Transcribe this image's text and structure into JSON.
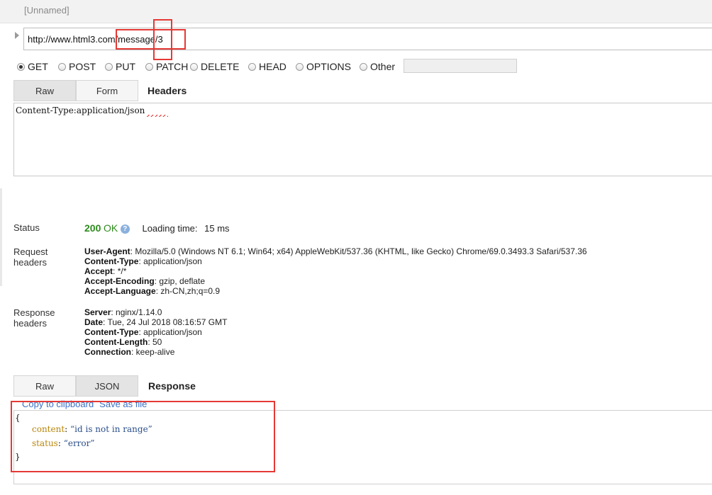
{
  "request": {
    "name": "[Unnamed]",
    "url": "http://www.html3.com/message/3",
    "methods": [
      {
        "label": "GET",
        "checked": true
      },
      {
        "label": "POST",
        "checked": false
      },
      {
        "label": "PUT",
        "checked": false
      },
      {
        "label": "PATCH",
        "checked": false
      },
      {
        "label": "DELETE",
        "checked": false
      },
      {
        "label": "HEAD",
        "checked": false
      },
      {
        "label": "OPTIONS",
        "checked": false
      },
      {
        "label": "Other",
        "checked": false
      }
    ],
    "other_value": "",
    "tabs": {
      "raw": "Raw",
      "form": "Form",
      "section_label": "Headers",
      "active": "Raw"
    },
    "headers_text": "Content-Type:application/json"
  },
  "response": {
    "status_label": "Status",
    "status_code": "200",
    "status_text": "OK",
    "help_glyph": "?",
    "loading_label": "Loading time:",
    "loading_value": "15 ms",
    "request_headers_label_1": "Request",
    "request_headers_label_2": "headers",
    "request_headers": [
      {
        "name": "User-Agent",
        "value": "Mozilla/5.0 (Windows NT 6.1; Win64; x64) AppleWebKit/537.36 (KHTML, like Gecko) Chrome/69.0.3493.3 Safari/537.36"
      },
      {
        "name": "Content-Type",
        "value": "application/json"
      },
      {
        "name": "Accept",
        "value": "*/*"
      },
      {
        "name": "Accept-Encoding",
        "value": "gzip, deflate"
      },
      {
        "name": "Accept-Language",
        "value": "zh-CN,zh;q=0.9"
      }
    ],
    "response_headers_label_1": "Response",
    "response_headers_label_2": "headers",
    "response_headers": [
      {
        "name": "Server",
        "value": "nginx/1.14.0"
      },
      {
        "name": "Date",
        "value": "Tue, 24 Jul 2018 08:16:57 GMT"
      },
      {
        "name": "Content-Type",
        "value": "application/json"
      },
      {
        "name": "Content-Length",
        "value": "50"
      },
      {
        "name": "Connection",
        "value": "keep-alive"
      }
    ],
    "tabs": {
      "raw": "Raw",
      "json": "JSON",
      "section_label": "Response",
      "active": "JSON"
    },
    "copy_link": "Copy to clipboard",
    "save_link": "Save as file",
    "body": {
      "open_brace": "{",
      "close_brace": "}",
      "fields": [
        {
          "key": "content",
          "value": "“id is not in range”"
        },
        {
          "key": "status",
          "value": "“error”"
        }
      ]
    }
  },
  "colors": {
    "annotation_red": "#e53935",
    "status_green": "#2e8b1e",
    "link_blue": "#3b6fc4"
  }
}
